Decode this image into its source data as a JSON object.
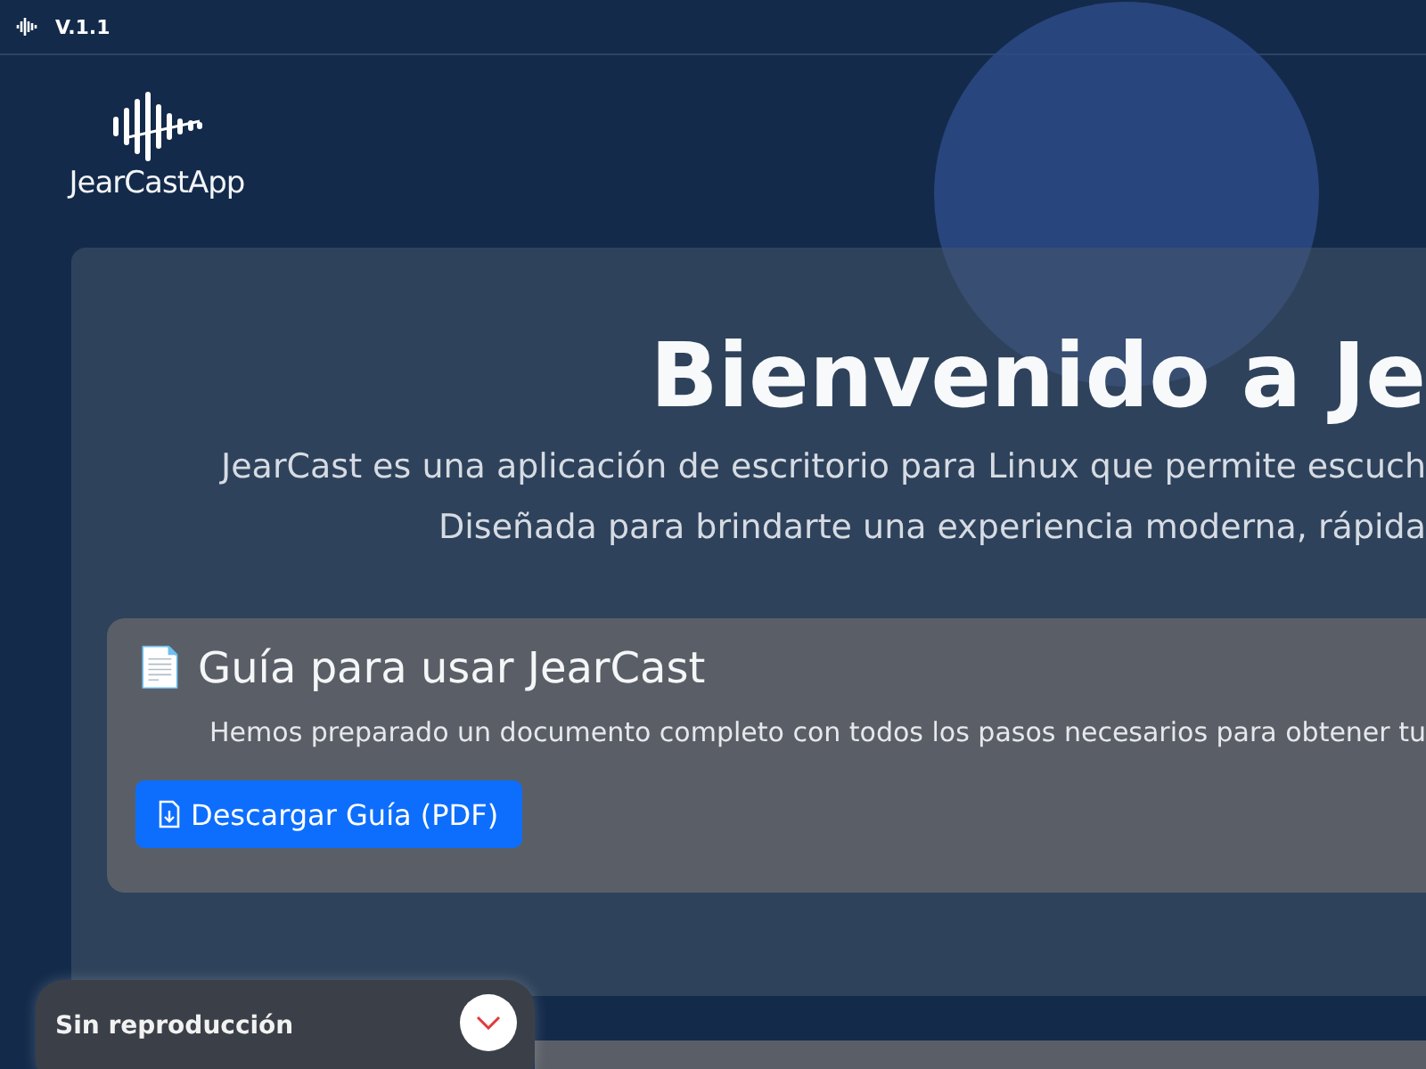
{
  "top_bar": {
    "version": "V.1.1"
  },
  "logo": {
    "name": "JearCastApp"
  },
  "hero": {
    "title": "Bienvenido a Je",
    "description": [
      "JearCast es una aplicación de escritorio para Linux que permite escuch",
      "Diseñada para brindarte una experiencia moderna, rápida"
    ]
  },
  "guide_card": {
    "icon": "📄",
    "title": "Guía para usar JearCast",
    "text": "Hemos preparado un documento completo con todos los pasos necesarios para obtener tu",
    "button": "Descargar Guía (PDF)"
  },
  "player": {
    "status": "Sin reproducción",
    "expanded": false
  }
}
